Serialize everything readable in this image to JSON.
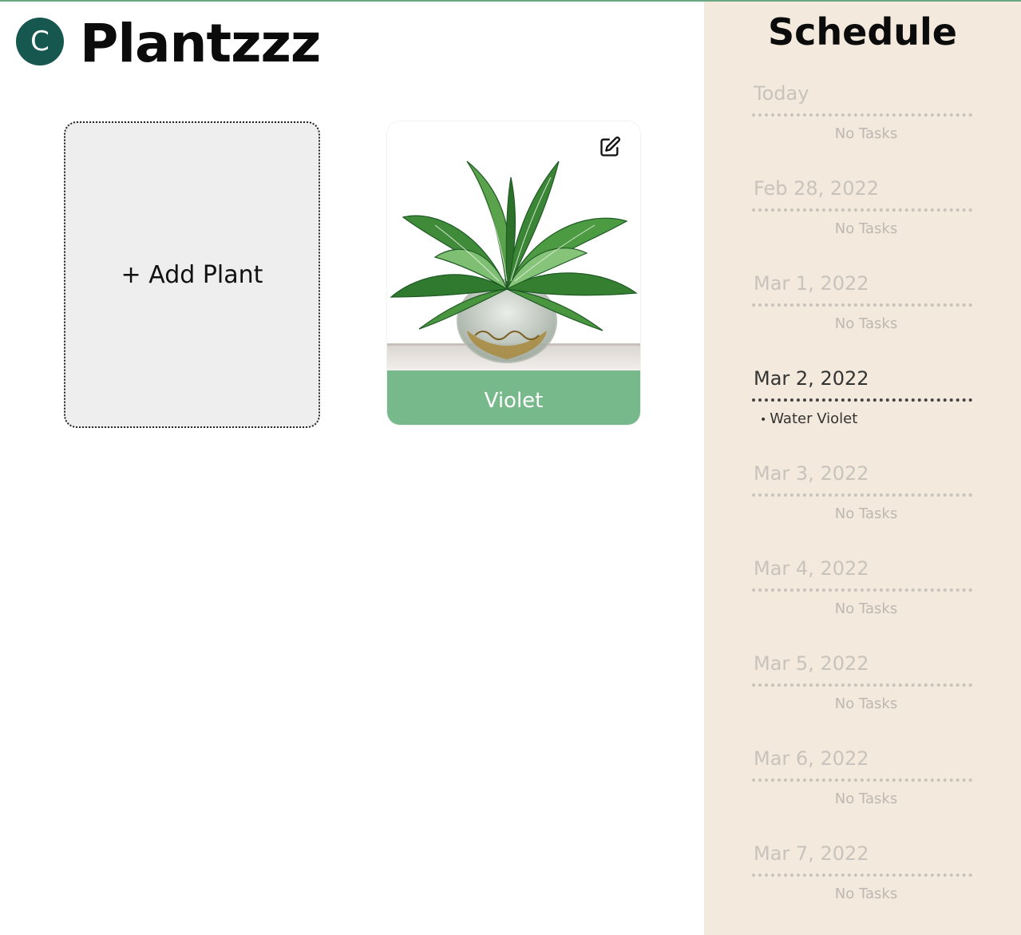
{
  "header": {
    "avatar_initial": "C",
    "app_title": "Plantzzz"
  },
  "add_plant": {
    "label": "+ Add Plant"
  },
  "plants": [
    {
      "name": "Violet",
      "image_icon": "potted-plant-image",
      "edit_icon": "edit-icon"
    }
  ],
  "schedule": {
    "title": "Schedule",
    "days": [
      {
        "date": "Today",
        "empty_text": "No Tasks"
      },
      {
        "date": "Feb 28, 2022",
        "empty_text": "No Tasks"
      },
      {
        "date": "Mar 1, 2022",
        "empty_text": "No Tasks"
      },
      {
        "date": "Mar 2, 2022",
        "task_bullet": "•",
        "task": "Water Violet"
      },
      {
        "date": "Mar 3, 2022",
        "empty_text": "No Tasks"
      },
      {
        "date": "Mar 4, 2022",
        "empty_text": "No Tasks"
      },
      {
        "date": "Mar 5, 2022",
        "empty_text": "No Tasks"
      },
      {
        "date": "Mar 6, 2022",
        "empty_text": "No Tasks"
      },
      {
        "date": "Mar 7, 2022",
        "empty_text": "No Tasks"
      }
    ]
  },
  "colors": {
    "avatar": "#16574f",
    "plant_name_bar": "#77b98b",
    "schedule_bg": "#f3e9dc",
    "add_card_bg": "#eeeeee"
  }
}
